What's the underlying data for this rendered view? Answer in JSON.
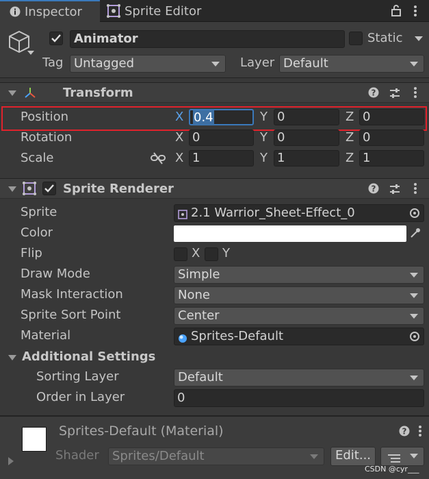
{
  "tabs": [
    {
      "label": "Inspector",
      "icon": "info-icon"
    },
    {
      "label": "Sprite Editor",
      "icon": "sprite-editor-icon"
    }
  ],
  "header": {
    "object_name": "Animator",
    "static_label": "Static",
    "tag_label": "Tag",
    "tag_value": "Untagged",
    "layer_label": "Layer",
    "layer_value": "Default"
  },
  "transform": {
    "title": "Transform",
    "position_label": "Position",
    "rotation_label": "Rotation",
    "scale_label": "Scale",
    "position": {
      "x": "0.4",
      "y": "0",
      "z": "0"
    },
    "rotation": {
      "x": "0",
      "y": "0",
      "z": "0"
    },
    "scale": {
      "x": "1",
      "y": "1",
      "z": "1"
    },
    "axis_x": "X",
    "axis_y": "Y",
    "axis_z": "Z"
  },
  "sprite_renderer": {
    "title": "Sprite Renderer",
    "sprite_label": "Sprite",
    "sprite_value": "2.1 Warrior_Sheet-Effect_0",
    "color_label": "Color",
    "color_value": "#ffffff",
    "flip_label": "Flip",
    "flip_x": "X",
    "flip_y": "Y",
    "draw_mode_label": "Draw Mode",
    "draw_mode_value": "Simple",
    "mask_label": "Mask Interaction",
    "mask_value": "None",
    "sort_point_label": "Sprite Sort Point",
    "sort_point_value": "Center",
    "material_label": "Material",
    "material_value": "Sprites-Default",
    "additional_title": "Additional Settings",
    "sorting_layer_label": "Sorting Layer",
    "sorting_layer_value": "Default",
    "order_label": "Order in Layer",
    "order_value": "0"
  },
  "material_panel": {
    "title": "Sprites-Default (Material)",
    "shader_label": "Shader",
    "shader_value": "Sprites/Default",
    "edit_label": "Edit..."
  },
  "watermark": "CSDN @cyr___",
  "colors": {
    "highlight": "#e0222c",
    "accent": "#3a79bb",
    "selection": "#3d6fa3"
  }
}
